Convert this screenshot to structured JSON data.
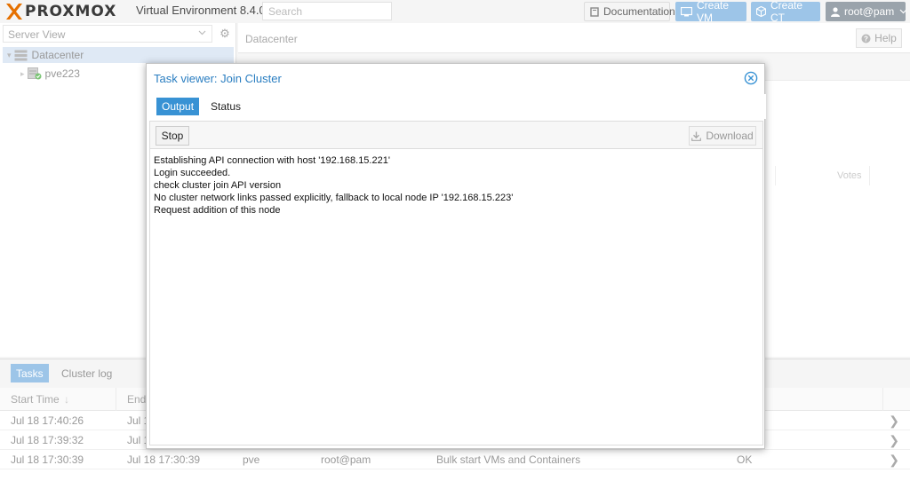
{
  "topbar": {
    "logo_text": "PROXMOX",
    "version": "Virtual Environment 8.4.0",
    "search_placeholder": "Search",
    "documentation": "Documentation",
    "create_vm": "Create VM",
    "create_ct": "Create CT",
    "user": "root@pam"
  },
  "leftpanel": {
    "view": "Server View",
    "tree": {
      "datacenter": "Datacenter",
      "node": "pve223"
    }
  },
  "content": {
    "title": "Datacenter",
    "help": "Help",
    "votes_label": "Votes"
  },
  "bottom": {
    "tabs": [
      "Tasks",
      "Cluster log"
    ],
    "columns": {
      "start_time": "Start Time",
      "end_time": "End"
    },
    "rows": [
      {
        "start": "Jul 18 17:40:26",
        "end": "Jul 1",
        "node": "",
        "user": "",
        "desc": "",
        "status": ""
      },
      {
        "start": "Jul 18 17:39:32",
        "end": "Jul 1",
        "node": "",
        "user": "",
        "desc": "",
        "status": ""
      },
      {
        "start": "Jul 18 17:30:39",
        "end": "Jul 18 17:30:39",
        "node": "pve",
        "user": "root@pam",
        "desc": "Bulk start VMs and Containers",
        "status": "OK"
      }
    ]
  },
  "modal": {
    "title": "Task viewer: Join Cluster",
    "tabs": {
      "output": "Output",
      "status": "Status"
    },
    "stop": "Stop",
    "download": "Download",
    "log": [
      "Establishing API connection with host '192.168.15.221'",
      "Login succeeded.",
      "check cluster join API version",
      "No cluster network links passed explicitly, fallback to local node IP '192.168.15.223'",
      "Request addition of this node"
    ]
  },
  "colors": {
    "accent": "#3892d4",
    "accent_faded": "#9dc5e8",
    "brand_orange": "#e57000",
    "title_blue": "#2a7ec1"
  },
  "icons": {
    "documentation": "book-icon",
    "create_vm": "monitor-icon",
    "create_ct": "cube-icon",
    "user": "user-icon",
    "help": "question-circle-icon",
    "close": "close-circle-icon",
    "download": "download-icon",
    "gear": "gear-icon"
  }
}
